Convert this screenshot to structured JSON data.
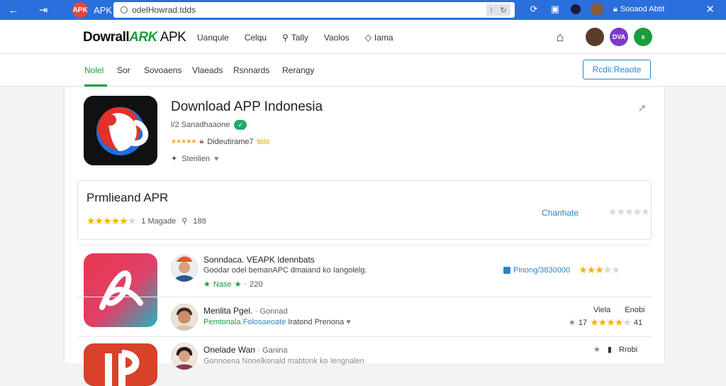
{
  "browser": {
    "tab_title": "APK",
    "tab_badge": "APK",
    "url": "odelHowrad.tdds",
    "profile_name": "Sooaod Abtit"
  },
  "header": {
    "logo_main": "Dowrall",
    "logo_mark": "ARK",
    "logo_apk": "APK",
    "nav": [
      "Uanqule",
      "Celqu",
      "Tally",
      "Vaolos",
      "Iama"
    ],
    "badge_1": "DVA",
    "badge_2": "s"
  },
  "subnav": {
    "items": [
      "Nolel",
      "Sor",
      "Sovoaens",
      "Vlaeads",
      "Rsnnards",
      "Rerangy"
    ],
    "active_index": 0,
    "button_label": "Rcdii:Reaote"
  },
  "app": {
    "title": "Download APP Indonesia",
    "developer": "l/2 Sanadhaaone",
    "rating_text": "Dideutirame7",
    "rating_value": "tolo",
    "subtext": "Stenlien"
  },
  "promo": {
    "title": "Prmlieand APR",
    "stars": 4,
    "meta_1": "1 Magade",
    "meta_2": "188",
    "link": "Chanhate",
    "right_stars": 0
  },
  "rows": [
    {
      "title": "Sonndaca. VEAPK Idennbats",
      "subtitle": "Goodar odel bemanAPC dmaiand ko Iangolelg.",
      "meta_count": "Nase",
      "meta_value": "220",
      "right_label": "Pinong/3830000",
      "right_stars": 3
    },
    {
      "title": "Menlita Pgel.",
      "title_suffix": "Gonnad",
      "subtitle_green": "Pemtonala",
      "subtitle_blue": "Folosaeoate",
      "subtitle_rest": "Iratond Prenona",
      "right_top_1": "Viela",
      "right_top_2": "Enobi",
      "right_count": "17",
      "right_stars": 4,
      "right_value": "41"
    },
    {
      "title": "Onelade Wan",
      "title_suffix": "Ganina",
      "subtitle": "Gonnoena Nonelkonald mabtonk ko Iengnalen",
      "right_top_1": "Rrobi"
    }
  ]
}
